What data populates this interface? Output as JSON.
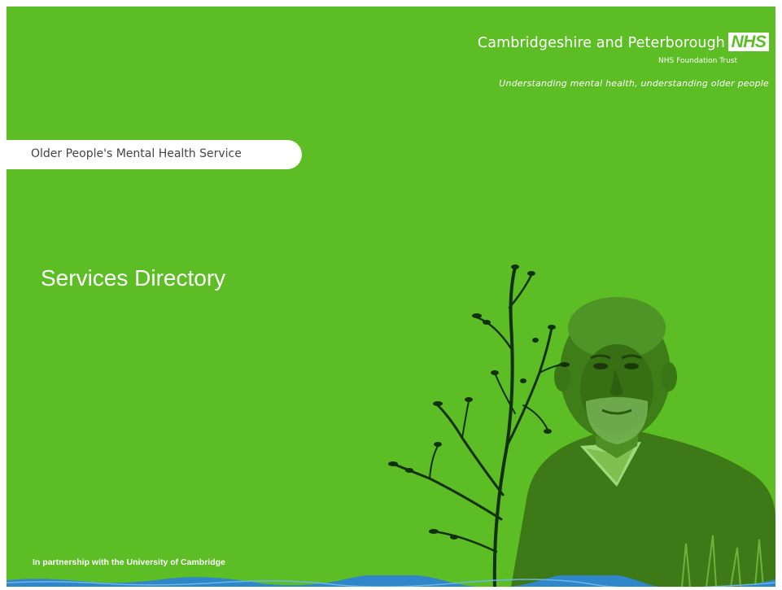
{
  "header": {
    "org_name": "Cambridgeshire and Peterborough",
    "nhs_logo": "NHS",
    "org_sub": "NHS Foundation Trust",
    "tagline": "Understanding mental health, understanding older people"
  },
  "banner": {
    "service": "Older People's Mental Health Service"
  },
  "main": {
    "title": "Services Directory"
  },
  "footer": {
    "partnership": "In partnership with the University of Cambridge"
  },
  "colors": {
    "background": "#5cbd24",
    "nhs_blue_band": "#2f86c9",
    "text": "#ffffff"
  },
  "icons": {
    "tree": "tree-illustration",
    "portrait": "person-photo"
  }
}
